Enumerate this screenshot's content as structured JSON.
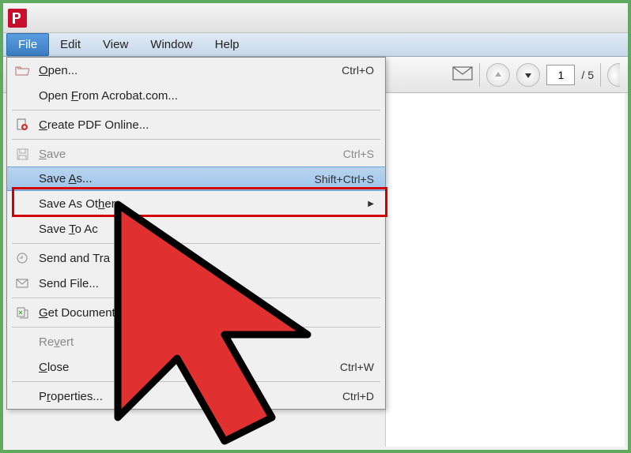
{
  "menubar": {
    "file": "File",
    "edit": "Edit",
    "view": "View",
    "window": "Window",
    "help": "Help"
  },
  "toolbar": {
    "page_current": "1",
    "page_total": "/ 5"
  },
  "menu": {
    "open": {
      "label": "Open...",
      "shortcut": "Ctrl+O"
    },
    "open_from": {
      "label": "Open From Acrobat.com..."
    },
    "create_pdf": {
      "label": "Create PDF Online..."
    },
    "save": {
      "label": "Save",
      "shortcut": "Ctrl+S"
    },
    "save_as": {
      "label": "Save As...",
      "shortcut": "Shift+Ctrl+S"
    },
    "save_as_other": {
      "label": "Save As Other..."
    },
    "save_to": {
      "label": "Save To Ac"
    },
    "send_track": {
      "label": "Send and Tra"
    },
    "send_file": {
      "label": "Send File..."
    },
    "get_docs": {
      "label": "Get Documents"
    },
    "revert": {
      "label": "Revert"
    },
    "close": {
      "label": "Close",
      "shortcut": "Ctrl+W"
    },
    "properties": {
      "label": "Properties...",
      "shortcut": "Ctrl+D"
    }
  }
}
